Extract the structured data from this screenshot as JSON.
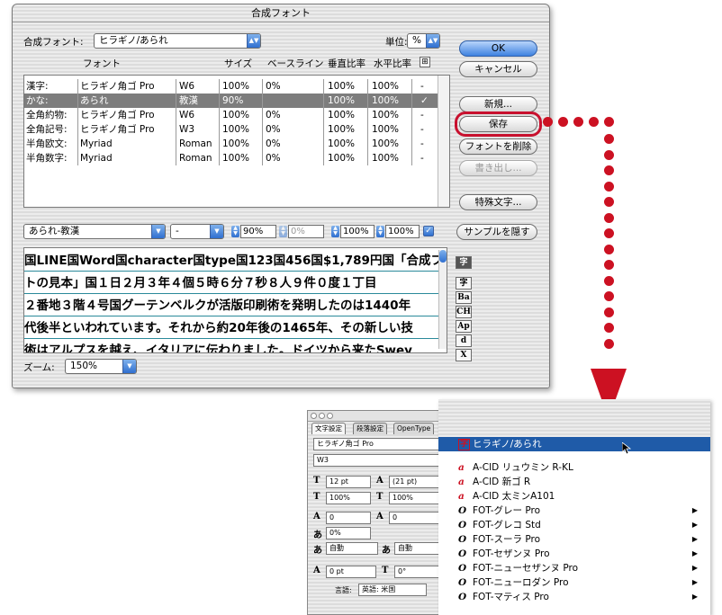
{
  "dialog": {
    "title": "合成フォント",
    "composite_label": "合成フォント:",
    "composite_value": "ヒラギノ/あられ",
    "unit_label": "単位:",
    "unit_value": "%",
    "columns": [
      "フォント",
      "サイズ",
      "ベースライン",
      "垂直比率",
      "水平比率"
    ],
    "rows": [
      {
        "cat": "漢字:",
        "font": "ヒラギノ角ゴ Pro",
        "weight": "W6",
        "size": "100%",
        "base": "0%",
        "vert": "100%",
        "horiz": "100%",
        "mark": "-",
        "selected": false
      },
      {
        "cat": "かな:",
        "font": "あられ",
        "weight": "教漢",
        "size": "90%",
        "base": "",
        "vert": "100%",
        "horiz": "100%",
        "mark": "✓",
        "selected": true
      },
      {
        "cat": "全角約物:",
        "font": "ヒラギノ角ゴ Pro",
        "weight": "W6",
        "size": "100%",
        "base": "0%",
        "vert": "100%",
        "horiz": "100%",
        "mark": "-",
        "selected": false
      },
      {
        "cat": "全角記号:",
        "font": "ヒラギノ角ゴ Pro",
        "weight": "W3",
        "size": "100%",
        "base": "0%",
        "vert": "100%",
        "horiz": "100%",
        "mark": "-",
        "selected": false
      },
      {
        "cat": "半角欧文:",
        "font": "Myriad",
        "weight": "Roman",
        "size": "100%",
        "base": "0%",
        "vert": "100%",
        "horiz": "100%",
        "mark": "-",
        "selected": false
      },
      {
        "cat": "半角数字:",
        "font": "Myriad",
        "weight": "Roman",
        "size": "100%",
        "base": "0%",
        "vert": "100%",
        "horiz": "100%",
        "mark": "-",
        "selected": false
      }
    ],
    "buttons": {
      "ok": "OK",
      "cancel": "キャンセル",
      "new": "新規...",
      "save": "保存",
      "delete_font": "フォントを削除",
      "export": "書き出し...",
      "special_chars": "特殊文字...",
      "hide_sample": "サンプルを隠す"
    },
    "edit_row": {
      "font": "あられ-教漢",
      "style": "-",
      "size": "90%",
      "baseline": "0%",
      "vertical": "100%",
      "horizontal": "100%"
    },
    "sample_lines": [
      "国LINE国Word国character国type国123国456国$1,789円国「合成フォン",
      "トの見本」国１日２月３年４個５時６分７秒８人９件０度１丁目",
      "２番地３階４号国グーテンベルクが活版印刷術を発明したのは1440年",
      "代後半といわれています。それから約20年後の1465年、その新しい技",
      "術はアルプスを越え、イタリアに伝わりました。ドイツから来たSwey"
    ],
    "sample_tools": [
      "字",
      "字",
      "Ba",
      "CH",
      "Ap",
      "d",
      "X"
    ],
    "zoom_label": "ズーム:",
    "zoom_value": "150%"
  },
  "char_panel": {
    "tabs": [
      "文字設定",
      "段落設定",
      "OpenType"
    ],
    "font_family": "ヒラギノ角ゴ Pro",
    "font_style": "W3",
    "size": "12 pt",
    "leading": "(21 pt)",
    "vscale": "100%",
    "hscale": "100%",
    "kerning": "0",
    "tracking": "0",
    "tsume": "0%",
    "auto1": "自動",
    "auto2": "自動",
    "baseline_shift": "0 pt",
    "rotation": "0°",
    "language_label": "言語:",
    "language_value": "英語: 米国"
  },
  "font_menu": {
    "items": [
      {
        "icon": "字",
        "label": "ヒラギノ/あられ",
        "type": "composite",
        "highlighted": true,
        "submenu": false
      },
      {
        "icon": "a",
        "label": "A-CID リュウミン R-KL",
        "type": "cid",
        "highlighted": false,
        "submenu": false
      },
      {
        "icon": "a",
        "label": "A-CID 新ゴ R",
        "type": "cid",
        "highlighted": false,
        "submenu": false
      },
      {
        "icon": "a",
        "label": "A-CID 太ミンA101",
        "type": "cid",
        "highlighted": false,
        "submenu": false
      },
      {
        "icon": "O",
        "label": "FOT-グレー Pro",
        "type": "otf",
        "highlighted": false,
        "submenu": true
      },
      {
        "icon": "O",
        "label": "FOT-グレコ Std",
        "type": "otf",
        "highlighted": false,
        "submenu": true
      },
      {
        "icon": "O",
        "label": "FOT-スーラ Pro",
        "type": "otf",
        "highlighted": false,
        "submenu": true
      },
      {
        "icon": "O",
        "label": "FOT-セザンヌ Pro",
        "type": "otf",
        "highlighted": false,
        "submenu": true
      },
      {
        "icon": "O",
        "label": "FOT-ニューセザンヌ Pro",
        "type": "otf",
        "highlighted": false,
        "submenu": true
      },
      {
        "icon": "O",
        "label": "FOT-ニューロダン Pro",
        "type": "otf",
        "highlighted": false,
        "submenu": true
      },
      {
        "icon": "O",
        "label": "FOT-マティス Pro",
        "type": "otf",
        "highlighted": false,
        "submenu": true
      }
    ]
  },
  "colors": {
    "annotation_red": "#cc1122",
    "selection_blue": "#1f5ba8",
    "aqua_blue": "#3e82e0"
  }
}
